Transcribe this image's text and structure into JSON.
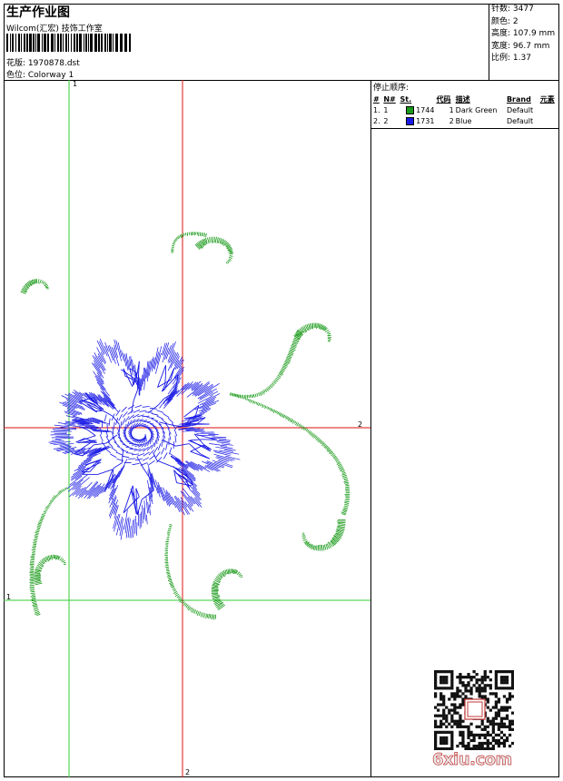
{
  "header": {
    "title": "生产作业图",
    "company": "Wilcom(汇宏) 技饰工作室",
    "design_label": "花版: 1970878.dst",
    "colorway_label": "色位: Colorway 1"
  },
  "stats": [
    {
      "label": "针数",
      "value": "3477"
    },
    {
      "label": "颜色",
      "value": "2"
    },
    {
      "label": "高度",
      "value": "107.9 mm"
    },
    {
      "label": "宽度",
      "value": "96.7 mm"
    },
    {
      "label": "比例",
      "value": "1.37"
    }
  ],
  "stop_sequence": {
    "title": "停止顺序:",
    "headers": [
      "#",
      "N#",
      "St.",
      "代码",
      "描述",
      "Brand",
      "元素"
    ],
    "rows": [
      {
        "index": "1.",
        "n": "1",
        "st": "1744",
        "code": "1",
        "desc": "Dark Green",
        "brand": "Default",
        "color": "#1a9a1a"
      },
      {
        "index": "2.",
        "n": "2",
        "st": "1731",
        "code": "2",
        "desc": "Blue",
        "brand": "Default",
        "color": "#1a1ae6"
      }
    ]
  },
  "axis_labels": {
    "green_vertical": "1",
    "green_horizontal": "1",
    "red_horizontal": "2",
    "red_vertical": "2"
  },
  "colors": {
    "thread1": "#1a9a1a",
    "thread2": "#1a1ae6",
    "guide_green": "#33cc33",
    "guide_red": "#dd1111"
  },
  "watermark": {
    "text": "6xiu.com"
  }
}
